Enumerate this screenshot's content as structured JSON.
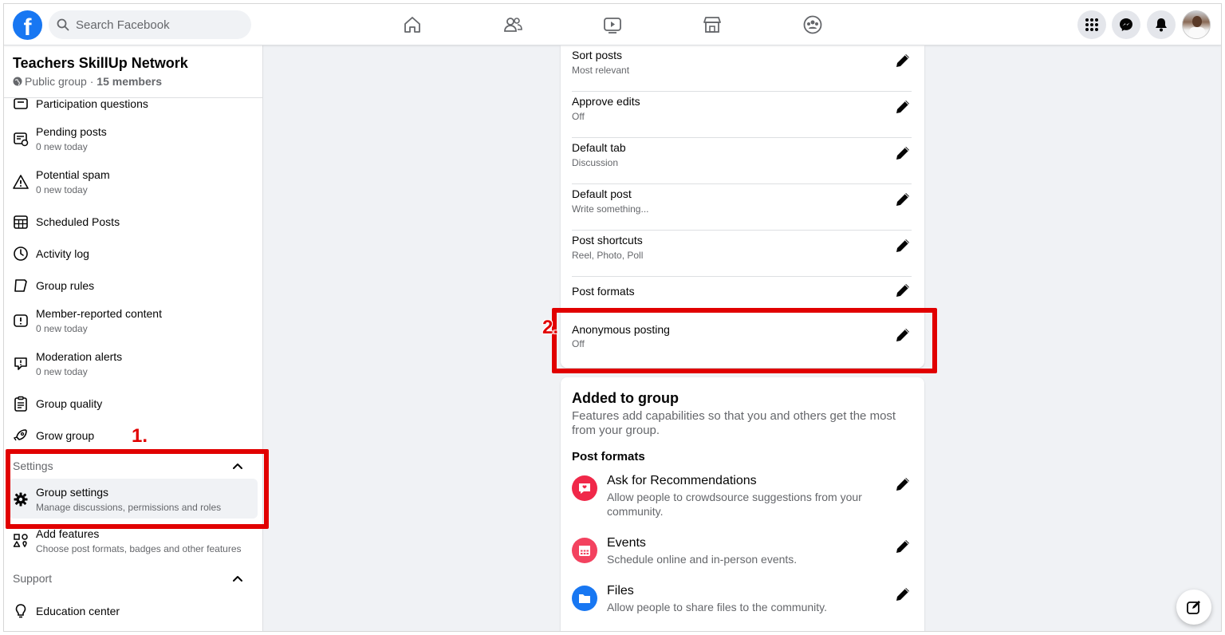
{
  "topbar": {
    "logo": "f",
    "search_placeholder": "Search Facebook",
    "nav_icons": [
      "home-icon",
      "friends-icon",
      "watch-icon",
      "marketplace-icon",
      "groups-icon"
    ],
    "right_icons": [
      "menu-grid-icon",
      "messenger-icon",
      "notifications-icon",
      "profile-avatar"
    ]
  },
  "sidebar": {
    "group_name": "Teachers SkillUp Network",
    "group_privacy": "Public group",
    "group_separator": " · ",
    "group_members": "15 members",
    "items": [
      {
        "label": "Participation questions",
        "sub": ""
      },
      {
        "label": "Pending posts",
        "sub": "0 new today"
      },
      {
        "label": "Potential spam",
        "sub": "0 new today"
      },
      {
        "label": "Scheduled Posts",
        "sub": ""
      },
      {
        "label": "Activity log",
        "sub": ""
      },
      {
        "label": "Group rules",
        "sub": ""
      },
      {
        "label": "Member-reported content",
        "sub": "0 new today"
      },
      {
        "label": "Moderation alerts",
        "sub": "0 new today"
      },
      {
        "label": "Group quality",
        "sub": ""
      },
      {
        "label": "Grow group",
        "sub": ""
      }
    ],
    "settings_section": "Settings",
    "settings_items": [
      {
        "label": "Group settings",
        "sub": "Manage discussions, permissions and roles"
      },
      {
        "label": "Add features",
        "sub": "Choose post formats, badges and other features"
      }
    ],
    "support_section": "Support",
    "support_items": [
      {
        "label": "Education center",
        "sub": ""
      }
    ]
  },
  "settings_rows": [
    {
      "label": "Sort posts",
      "value": "Most relevant"
    },
    {
      "label": "Approve edits",
      "value": "Off"
    },
    {
      "label": "Default tab",
      "value": "Discussion"
    },
    {
      "label": "Default post",
      "value": "Write something..."
    },
    {
      "label": "Post shortcuts",
      "value": "Reel, Photo, Poll"
    },
    {
      "label": "Post formats",
      "value": ""
    },
    {
      "label": "Anonymous posting",
      "value": "Off"
    }
  ],
  "added_to_group": {
    "heading": "Added to group",
    "description": "Features add capabilities so that you and others get the most from your group.",
    "subheading": "Post formats",
    "features": [
      {
        "title": "Ask for Recommendations",
        "desc": "Allow people to crowdsource suggestions from your community.",
        "icon": "recommendations-icon",
        "color": "#f02849"
      },
      {
        "title": "Events",
        "desc": "Schedule online and in-person events.",
        "icon": "calendar-icon",
        "color": "#f3425f"
      },
      {
        "title": "Files",
        "desc": "Allow people to share files to the community.",
        "icon": "folder-icon",
        "color": "#1877f2"
      }
    ]
  },
  "annotations": {
    "step1": "1.",
    "step2": "2.",
    "color": "#e10000"
  },
  "colors": {
    "brand": "#1877f2",
    "background": "#f0f2f5",
    "secondary_text": "#65676b"
  }
}
